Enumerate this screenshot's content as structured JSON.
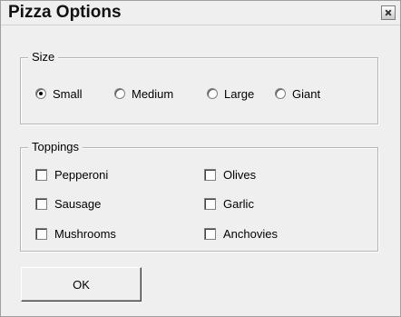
{
  "window": {
    "title": "Pizza Options"
  },
  "size_group": {
    "label": "Size",
    "options": [
      {
        "label": "Small",
        "selected": true
      },
      {
        "label": "Medium",
        "selected": false
      },
      {
        "label": "Large",
        "selected": false
      },
      {
        "label": "Giant",
        "selected": false
      }
    ]
  },
  "toppings_group": {
    "label": "Toppings",
    "options": [
      {
        "label": "Pepperoni",
        "checked": false
      },
      {
        "label": "Olives",
        "checked": false
      },
      {
        "label": "Sausage",
        "checked": false
      },
      {
        "label": "Garlic",
        "checked": false
      },
      {
        "label": "Mushrooms",
        "checked": false
      },
      {
        "label": "Anchovies",
        "checked": false
      }
    ]
  },
  "buttons": {
    "ok_label": "OK"
  }
}
